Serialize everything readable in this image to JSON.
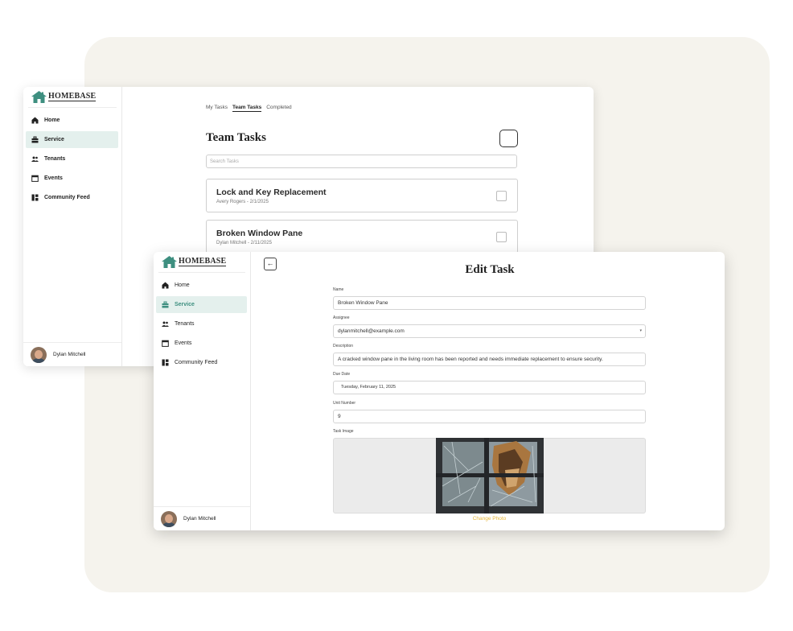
{
  "brand": {
    "name": "HOMEBASE",
    "color": "#3e8f80"
  },
  "nav": [
    {
      "label": "Home",
      "icon": "home-icon"
    },
    {
      "label": "Service",
      "icon": "toolbox-icon",
      "active": true
    },
    {
      "label": "Tenants",
      "icon": "people-icon"
    },
    {
      "label": "Events",
      "icon": "calendar-icon"
    },
    {
      "label": "Community Feed",
      "icon": "grid-icon"
    }
  ],
  "user": {
    "name": "Dylan Mitchell"
  },
  "team_tasks": {
    "tabs": [
      "My Tasks",
      "Team Tasks",
      "Completed"
    ],
    "active_tab": "Team Tasks",
    "title": "Team Tasks",
    "search_placeholder": "Search Tasks",
    "cards": [
      {
        "title": "Lock and Key Replacement",
        "subtitle": "Avery Rogers - 2/1/2025"
      },
      {
        "title": "Broken Window Pane",
        "subtitle": "Dylan Mitchell - 2/11/2025"
      }
    ]
  },
  "edit_task": {
    "back_glyph": "←",
    "title": "Edit Task",
    "fields": {
      "name": {
        "label": "Name",
        "value": "Broken Window Pane"
      },
      "assignee": {
        "label": "Assignee",
        "value": "dylanmitchell@example.com"
      },
      "description": {
        "label": "Description",
        "value": "A cracked window pane in the living room has been reported and needs immediate replacement to ensure security."
      },
      "due_date": {
        "label": "Due Date",
        "value": "Tuesday, February 11, 2025"
      },
      "unit_number": {
        "label": "Unit Number",
        "value": "9"
      },
      "task_image": {
        "label": "Task Image"
      }
    },
    "change_photo": "Change Photo"
  },
  "colors": {
    "accent": "#3e8f80",
    "active_nav_bg": "#e4f0ed",
    "link": "#e8b73a",
    "background_panel": "#f5f3ed"
  }
}
